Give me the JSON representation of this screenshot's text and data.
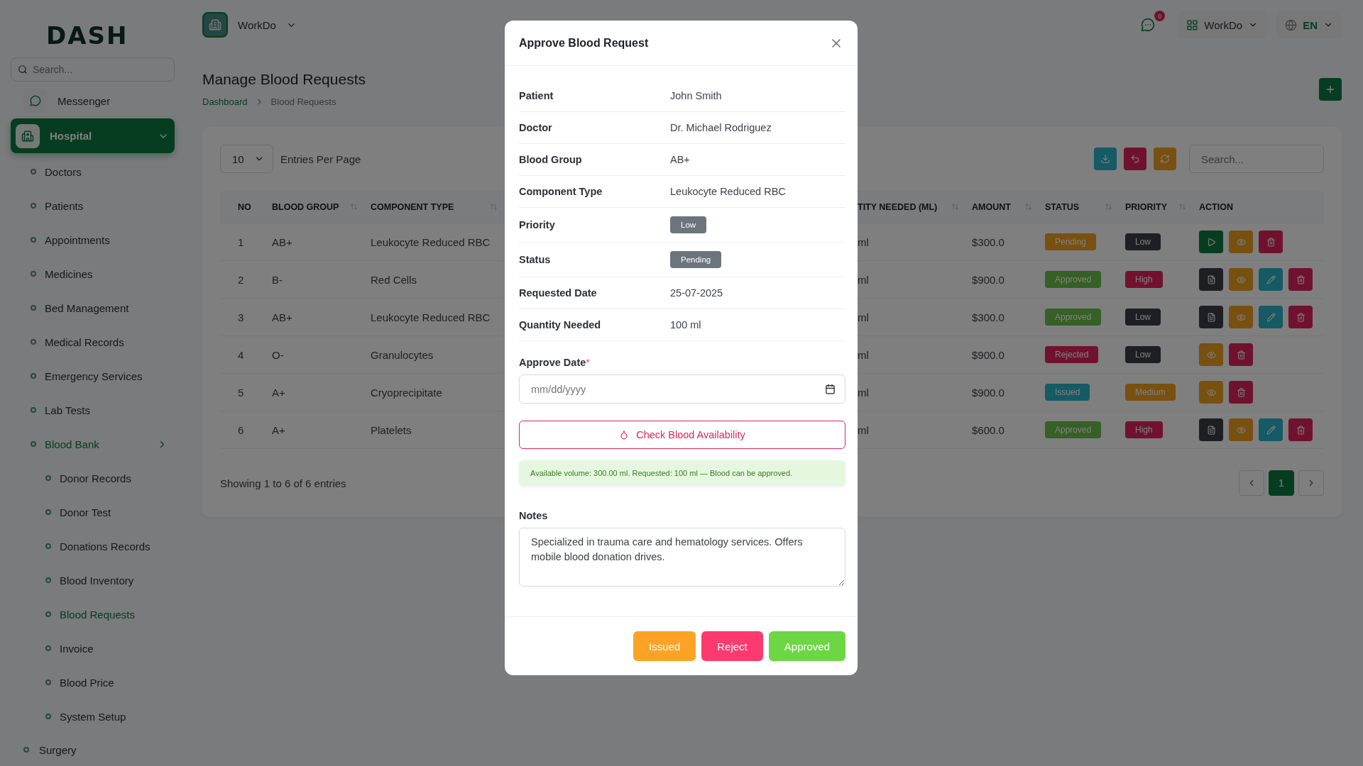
{
  "brand": {
    "logo": "DASH"
  },
  "sidebar": {
    "search": {
      "placeholder": "Search..."
    },
    "items": [
      {
        "label": "Messenger",
        "selected": false
      },
      {
        "label": "Hospital",
        "selected": true,
        "expanded": true,
        "children": [
          {
            "label": "Doctors",
            "selected": false
          },
          {
            "label": "Patients",
            "selected": false
          },
          {
            "label": "Appointments",
            "selected": false
          },
          {
            "label": "Medicines",
            "selected": false
          },
          {
            "label": "Bed Management",
            "selected": false
          },
          {
            "label": "Medical Records",
            "selected": false
          },
          {
            "label": "Emergency Services",
            "selected": false
          },
          {
            "label": "Lab Tests",
            "selected": false
          },
          {
            "label": "Blood Bank",
            "selected": true,
            "expanded": true,
            "children": [
              {
                "label": "Donor Records",
                "selected": false
              },
              {
                "label": "Donor Test",
                "selected": false
              },
              {
                "label": "Donations Records",
                "selected": false
              },
              {
                "label": "Blood Inventory",
                "selected": false
              },
              {
                "label": "Blood Requests",
                "selected": true
              },
              {
                "label": "Invoice",
                "selected": false
              },
              {
                "label": "Blood Price",
                "selected": false
              },
              {
                "label": "System Setup",
                "selected": false
              }
            ]
          }
        ]
      },
      {
        "label": "Surgery",
        "selected": false
      }
    ]
  },
  "topbar": {
    "workspace": "WorkDo",
    "notifications": "0",
    "account": "WorkDo",
    "language": "EN"
  },
  "page": {
    "title": "Manage Blood Requests",
    "breadcrumb": [
      "Dashboard",
      "Blood Requests"
    ]
  },
  "table": {
    "entries": "10",
    "entries_label": "Entries Per Page",
    "search": {
      "placeholder": "Search..."
    },
    "columns": [
      "NO",
      "BLOOD GROUP",
      "COMPONENT TYPE",
      "TITY NEEDED (ML)",
      "AMOUNT",
      "STATUS",
      "PRIORITY",
      "ACTION"
    ],
    "rows": [
      {
        "no": "1",
        "blood_group": "AB+",
        "component": "Leukocyte Reduced RBC",
        "quantity": "ml",
        "amount": "$300.0",
        "status": {
          "text": "Pending",
          "kind": "pending"
        },
        "priority": {
          "text": "Low",
          "kind": "low"
        },
        "actions": [
          {
            "kind": "approve"
          },
          {
            "kind": "view"
          },
          {
            "kind": "delete"
          }
        ]
      },
      {
        "no": "2",
        "blood_group": "B-",
        "component": "Red Cells",
        "quantity": "ml",
        "amount": "$900.0",
        "status": {
          "text": "Approved",
          "kind": "approved"
        },
        "priority": {
          "text": "High",
          "kind": "high"
        },
        "actions": [
          {
            "kind": "invoice"
          },
          {
            "kind": "view"
          },
          {
            "kind": "edit"
          },
          {
            "kind": "delete"
          }
        ]
      },
      {
        "no": "3",
        "blood_group": "AB+",
        "component": "Leukocyte Reduced RBC",
        "quantity": "ml",
        "amount": "$300.0",
        "status": {
          "text": "Approved",
          "kind": "approved"
        },
        "priority": {
          "text": "Low",
          "kind": "low"
        },
        "actions": [
          {
            "kind": "invoice"
          },
          {
            "kind": "view"
          },
          {
            "kind": "edit"
          },
          {
            "kind": "delete"
          }
        ]
      },
      {
        "no": "4",
        "blood_group": "O-",
        "component": "Granulocytes",
        "quantity": "ml",
        "amount": "$900.0",
        "status": {
          "text": "Rejected",
          "kind": "rejected"
        },
        "priority": {
          "text": "Low",
          "kind": "low"
        },
        "actions": [
          {
            "kind": "view"
          },
          {
            "kind": "delete"
          }
        ]
      },
      {
        "no": "5",
        "blood_group": "A+",
        "component": "Cryoprecipitate",
        "quantity": "ml",
        "amount": "$900.0",
        "status": {
          "text": "Issued",
          "kind": "issued"
        },
        "priority": {
          "text": "Medium",
          "kind": "medium"
        },
        "actions": [
          {
            "kind": "view"
          },
          {
            "kind": "delete"
          }
        ]
      },
      {
        "no": "6",
        "blood_group": "A+",
        "component": "Platelets",
        "quantity": "ml",
        "amount": "$600.0",
        "status": {
          "text": "Approved",
          "kind": "approved"
        },
        "priority": {
          "text": "High",
          "kind": "high"
        },
        "actions": [
          {
            "kind": "invoice"
          },
          {
            "kind": "view"
          },
          {
            "kind": "edit"
          },
          {
            "kind": "delete"
          }
        ]
      }
    ],
    "footer": "Showing 1 to 6 of 6 entries",
    "pages": [
      {
        "label": "1",
        "selected": true
      }
    ]
  },
  "modal": {
    "title": "Approve Blood Request",
    "details": [
      {
        "label": "Patient",
        "value": "John Smith",
        "kind": "text"
      },
      {
        "label": "Doctor",
        "value": "Dr. Michael Rodriguez",
        "kind": "text"
      },
      {
        "label": "Blood Group",
        "value": "AB+",
        "kind": "text"
      },
      {
        "label": "Component Type",
        "value": "Leukocyte Reduced RBC",
        "kind": "text"
      },
      {
        "label": "Priority",
        "value": "Low",
        "kind": "badge"
      },
      {
        "label": "Status",
        "value": "Pending",
        "kind": "badge"
      },
      {
        "label": "Requested Date",
        "value": "25-07-2025",
        "kind": "text"
      },
      {
        "label": "Quantity Needed",
        "value": "100 ml",
        "kind": "text"
      }
    ],
    "approve_date": {
      "label": "Approve Date",
      "required_mark": "*",
      "placeholder": "mm/dd/yyyy"
    },
    "check_button": "Check Blood Availability",
    "availability": "Available volume: 300.00 ml. Requested: 100 ml — Blood can be approved.",
    "notes": {
      "label": "Notes",
      "value": "Specialized in trauma care and hematology services. Offers mobile blood donation drives."
    },
    "buttons": [
      {
        "label": "Issued",
        "color": "#fca326"
      },
      {
        "label": "Reject",
        "color": "#fc3a6f"
      },
      {
        "label": "Approved",
        "color": "#6dd644"
      }
    ]
  }
}
